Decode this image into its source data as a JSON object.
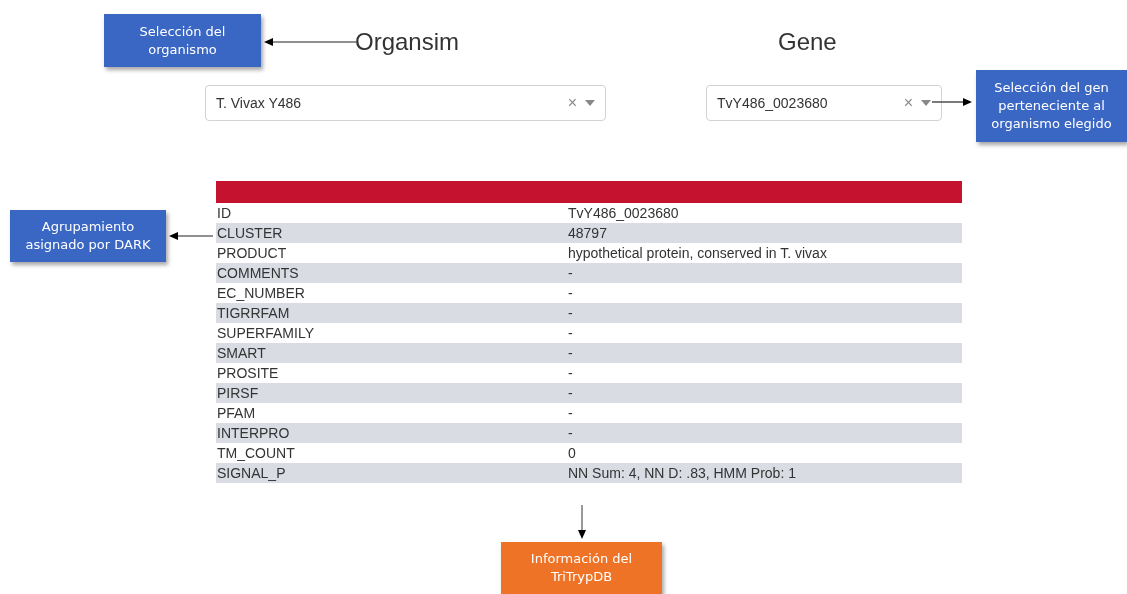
{
  "selectors": [
    {
      "label": "Organsim",
      "value": "T. Vivax Y486",
      "clear": "×"
    },
    {
      "label": "Gene",
      "value": "TvY486_0023680",
      "clear": "×"
    }
  ],
  "table": {
    "rows": [
      {
        "field": "ID",
        "value": "TvY486_0023680"
      },
      {
        "field": "CLUSTER",
        "value": "48797"
      },
      {
        "field": "PRODUCT",
        "value": "hypothetical protein, conserved in T. vivax"
      },
      {
        "field": "COMMENTS",
        "value": "-"
      },
      {
        "field": "EC_NUMBER",
        "value": "-"
      },
      {
        "field": "TIGRRFAM",
        "value": "-"
      },
      {
        "field": "SUPERFAMILY",
        "value": "-"
      },
      {
        "field": "SMART",
        "value": "-"
      },
      {
        "field": "PROSITE",
        "value": "-"
      },
      {
        "field": "PIRSF",
        "value": "-"
      },
      {
        "field": "PFAM",
        "value": "-"
      },
      {
        "field": "INTERPRO",
        "value": "-"
      },
      {
        "field": "TM_COUNT",
        "value": "0"
      },
      {
        "field": "SIGNAL_P",
        "value": "NN Sum: 4, NN D: .83, HMM Prob: 1"
      }
    ]
  },
  "callouts": [
    {
      "text": "Selección del organismo",
      "color": "#3a66c4",
      "kind": "top-left"
    },
    {
      "text": "Selección del gen perteneciente al organismo elegido",
      "color": "#3a66c4",
      "kind": "right"
    },
    {
      "text": "Agrupamiento asignado por DARK",
      "color": "#3a66c4",
      "kind": "left"
    },
    {
      "text": "Información del TriTrypDB",
      "color": "#ee7326",
      "kind": "bottom"
    }
  ]
}
